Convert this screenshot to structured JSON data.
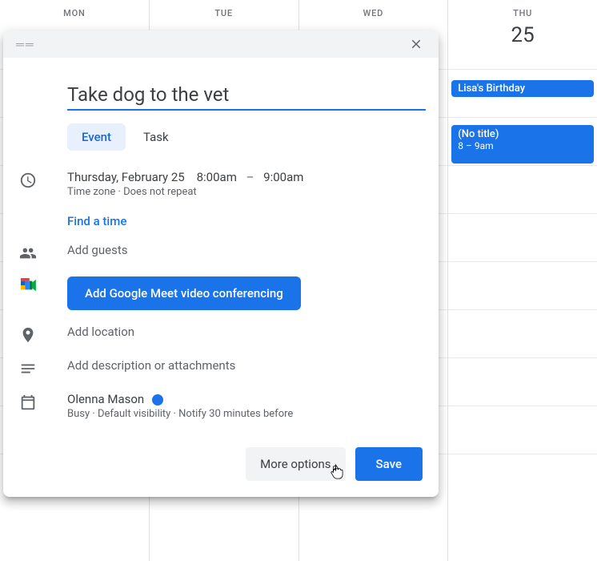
{
  "calendar": {
    "days": [
      {
        "label": "MON",
        "number": ""
      },
      {
        "label": "TUE",
        "number": ""
      },
      {
        "label": "WED",
        "number": ""
      },
      {
        "label": "THU",
        "number": "25"
      }
    ],
    "thu_events": {
      "allday": {
        "title": "Lisa's Birthday"
      },
      "timed": {
        "title": "(No title)",
        "time": "8 – 9am"
      }
    }
  },
  "modal": {
    "title_value": "Take dog to the vet",
    "tabs": {
      "event": "Event",
      "task": "Task"
    },
    "date": "Thursday, February 25",
    "start": "8:00am",
    "dash": "–",
    "end": "9:00am",
    "tz_repeat": "Time zone  ·  Does not repeat",
    "find_time": "Find a time",
    "add_guests": "Add guests",
    "meet_button": "Add Google Meet video conferencing",
    "add_location": "Add location",
    "add_description": "Add description or attachments",
    "owner": "Olenna Mason",
    "owner_sub": "Busy  ·  Default visibility  ·  Notify 30 minutes before",
    "more_options": "More options",
    "save": "Save"
  }
}
